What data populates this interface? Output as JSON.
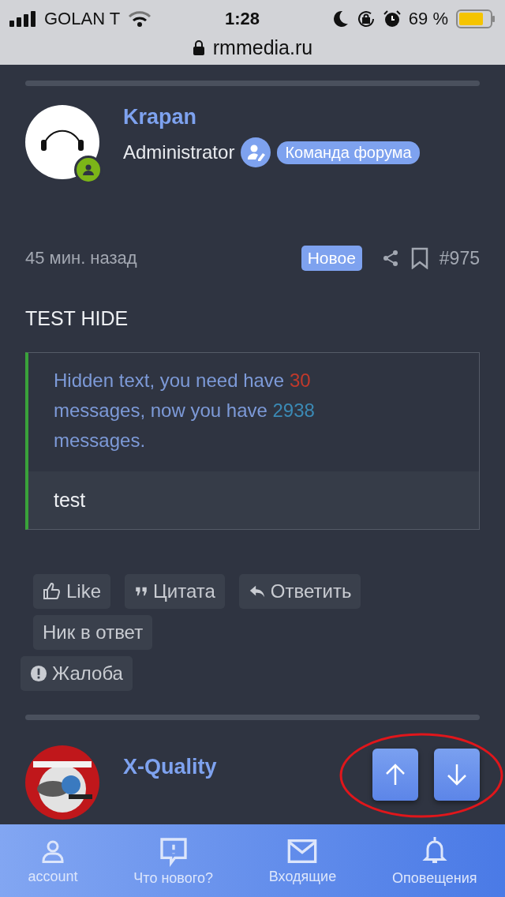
{
  "status_bar": {
    "carrier": "GOLAN T",
    "time": "1:28",
    "battery": "69 %"
  },
  "url_bar": {
    "domain": "rmmedia.ru"
  },
  "post": {
    "author": "Krapan",
    "role": "Administrator",
    "badge": "Команда форума",
    "time": "45 мин. назад",
    "new_label": "Новое",
    "number": "#975",
    "title": "TEST HIDE",
    "hidden_notice": [
      {
        "kind": "text",
        "text": "Hidden text, you need have "
      },
      {
        "kind": "required",
        "text": "30"
      },
      {
        "kind": "text",
        "text": " messages, now you have "
      },
      {
        "kind": "have",
        "text": "2938"
      },
      {
        "kind": "text",
        "text": " messages."
      }
    ],
    "hidden_content": "test",
    "actions": [
      {
        "kind": "like",
        "label": "Like"
      },
      {
        "kind": "quote",
        "label": "Цитата"
      },
      {
        "kind": "reply",
        "label": "Ответить"
      },
      {
        "kind": "nick",
        "label": "Ник в ответ"
      },
      {
        "kind": "report",
        "label": "Жалоба"
      }
    ]
  },
  "next_post": {
    "author": "X-Quality"
  },
  "bottom_nav": [
    {
      "kind": "account",
      "label": "account"
    },
    {
      "kind": "whats_new",
      "label": "Что нового?"
    },
    {
      "kind": "inbox",
      "label": "Входящие"
    },
    {
      "kind": "alerts",
      "label": "Оповещения"
    }
  ]
}
